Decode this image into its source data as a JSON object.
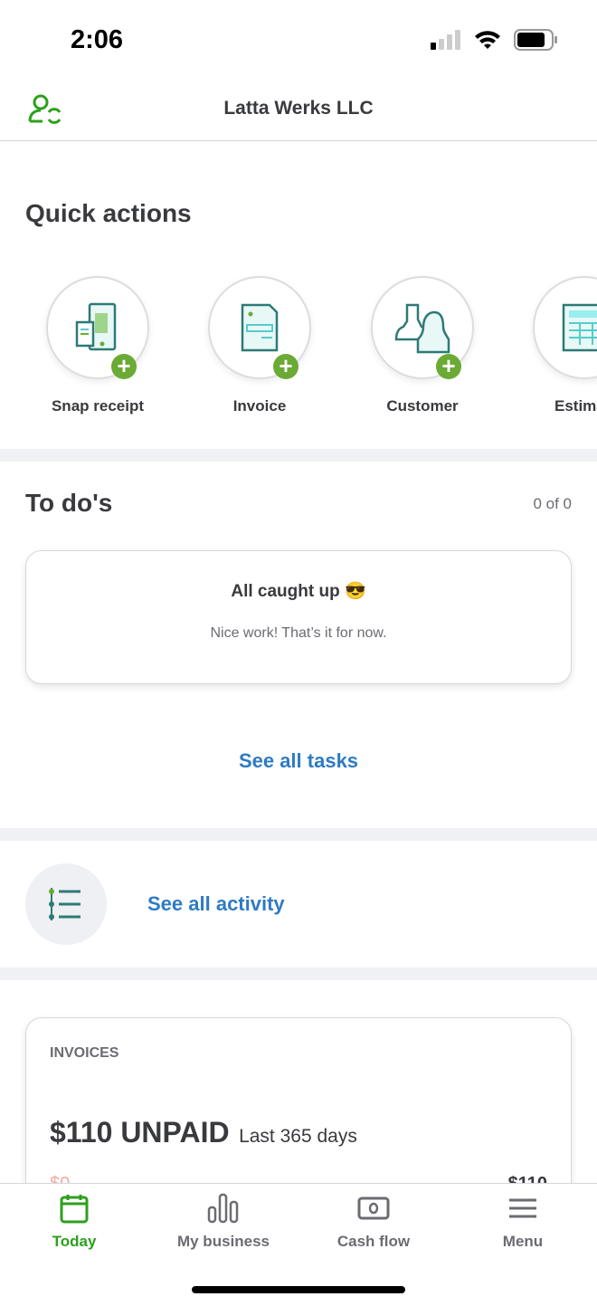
{
  "status": {
    "time": "2:06"
  },
  "header": {
    "title": "Latta Werks LLC"
  },
  "quick_actions": {
    "title": "Quick actions",
    "items": [
      {
        "label": "Snap receipt",
        "icon": "receipt-phone-icon"
      },
      {
        "label": "Invoice",
        "icon": "invoice-icon"
      },
      {
        "label": "Customer",
        "icon": "customer-icon"
      },
      {
        "label": "Estimate",
        "icon": "estimate-icon"
      }
    ]
  },
  "todos": {
    "title": "To do's",
    "count": "0 of 0",
    "card_title": "All caught up 😎",
    "card_text": "Nice work! That’s it for now.",
    "see_all": "See all tasks"
  },
  "activity": {
    "link": "See all activity"
  },
  "invoices": {
    "title": "INVOICES",
    "amount": "$110 UNPAID",
    "period": "Last 365 days",
    "left_label": "$0",
    "right_label": "$110"
  },
  "nav": {
    "items": [
      {
        "label": "Today",
        "active": true
      },
      {
        "label": "My business"
      },
      {
        "label": "Cash flow"
      },
      {
        "label": "Menu"
      }
    ]
  },
  "colors": {
    "accent": "#2ca01c",
    "link": "#2e7bc4",
    "plus": "#6aaa35"
  }
}
